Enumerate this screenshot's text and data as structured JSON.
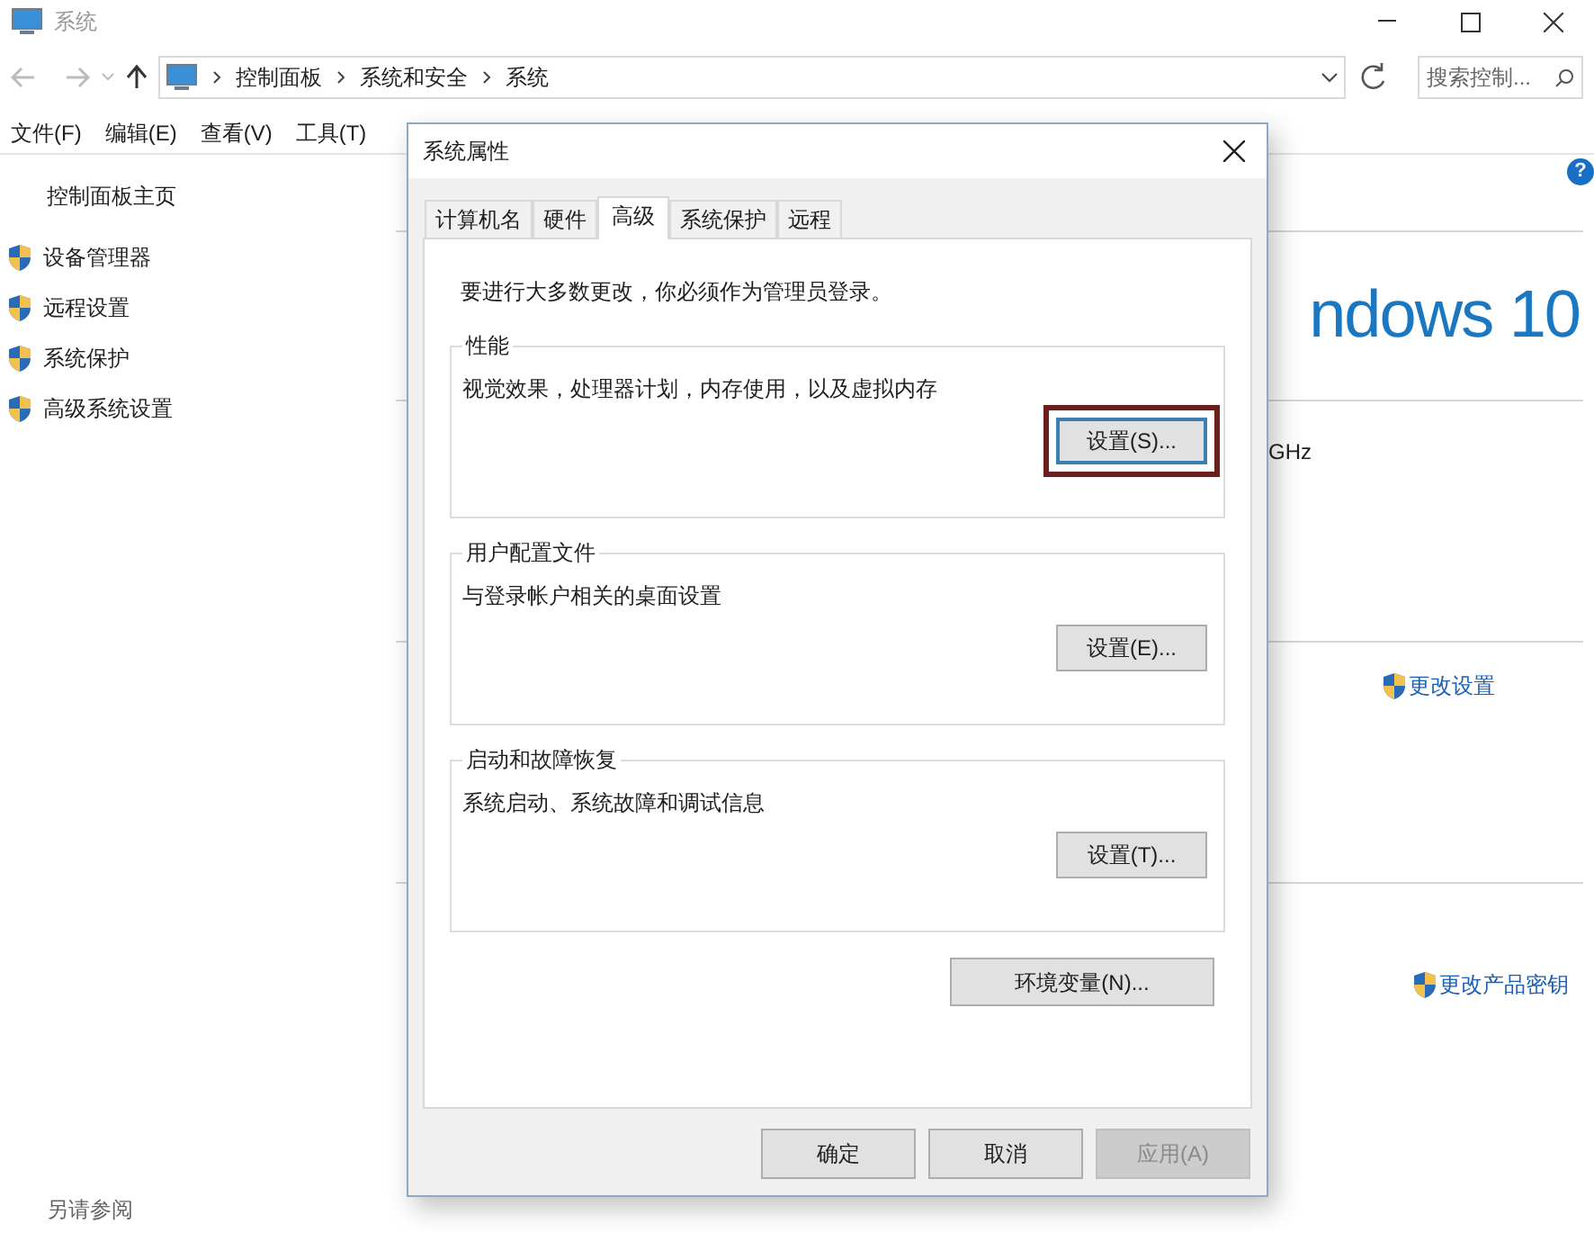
{
  "window": {
    "title": "系统"
  },
  "address": {
    "path": [
      "控制面板",
      "系统和安全",
      "系统"
    ],
    "search_placeholder": "搜索控制..."
  },
  "menu": [
    "文件(F)",
    "编辑(E)",
    "查看(V)",
    "工具(T)"
  ],
  "sidebar": {
    "home": "控制面板主页",
    "items": [
      "设备管理器",
      "远程设置",
      "系统保护",
      "高级系统设置"
    ],
    "see_also": "另请参阅"
  },
  "main": {
    "logo": "ndows 10",
    "cpu_fragment": "GHz",
    "change_settings": "更改设置",
    "change_key": "更改产品密钥",
    "help": "?"
  },
  "dialog": {
    "title": "系统属性",
    "tabs": [
      {
        "label": "计算机名",
        "selected": false
      },
      {
        "label": "硬件",
        "selected": false
      },
      {
        "label": "高级",
        "selected": true
      },
      {
        "label": "系统保护",
        "selected": false
      },
      {
        "label": "远程",
        "selected": false
      }
    ],
    "notice": "要进行大多数更改，你必须作为管理员登录。",
    "groups": [
      {
        "title": "性能",
        "description": "视觉效果，处理器计划，内存使用，以及虚拟内存",
        "button": "设置(S)...",
        "highlighted": true
      },
      {
        "title": "用户配置文件",
        "description": "与登录帐户相关的桌面设置",
        "button": "设置(E)...",
        "highlighted": false
      },
      {
        "title": "启动和故障恢复",
        "description": "系统启动、系统故障和调试信息",
        "button": "设置(T)...",
        "highlighted": false
      }
    ],
    "env_button": "环境变量(N)...",
    "footer": [
      {
        "label": "确定",
        "disabled": false
      },
      {
        "label": "取消",
        "disabled": false
      },
      {
        "label": "应用(A)",
        "disabled": true
      }
    ]
  }
}
